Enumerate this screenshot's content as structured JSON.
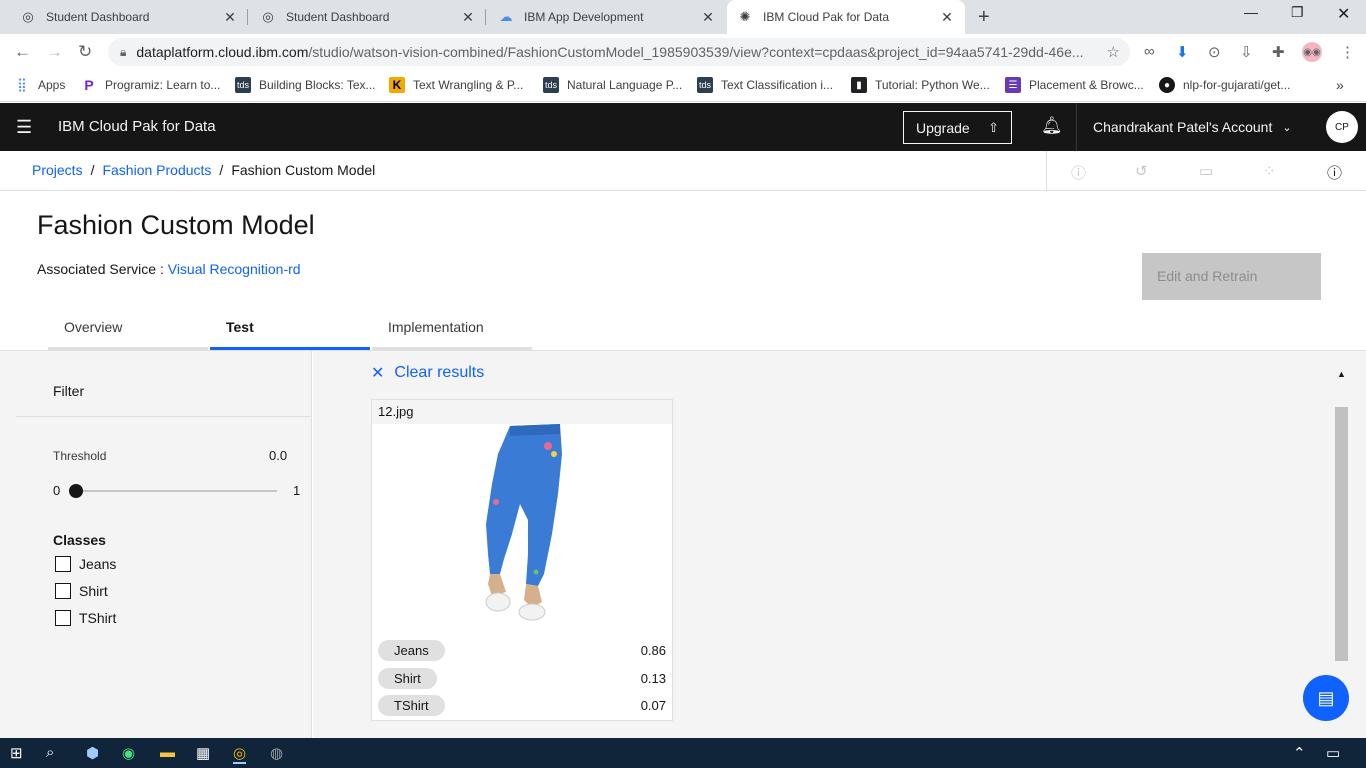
{
  "browser": {
    "tabs": [
      {
        "title": "Student Dashboard",
        "active": false
      },
      {
        "title": "Student Dashboard",
        "active": false
      },
      {
        "title": "IBM App Development",
        "active": false
      },
      {
        "title": "IBM Cloud Pak for Data",
        "active": true
      }
    ],
    "url_host": "dataplatform.cloud.ibm.com",
    "url_path": "/studio/watson-vision-combined/FashionCustomModel_1985903539/view?context=cpdaas&project_id=94aa5741-29dd-46e...",
    "bookmarks": [
      {
        "label": "Apps",
        "icon": "apps-grid-icon",
        "color": "#4285f4"
      },
      {
        "label": "Programiz: Learn to...",
        "icon": "programiz-icon",
        "color": "#6c2bd9"
      },
      {
        "label": "Building Blocks: Tex...",
        "icon": "tds-icon",
        "color": "#2d3e50"
      },
      {
        "label": "Text Wrangling & P...",
        "icon": "kaggle-icon",
        "color": "#f2a900"
      },
      {
        "label": "Natural Language P...",
        "icon": "tds-icon",
        "color": "#2d3e50"
      },
      {
        "label": "Text Classification i...",
        "icon": "tds-icon",
        "color": "#2d3e50"
      },
      {
        "label": "Tutorial: Python We...",
        "icon": "bookmark-icon",
        "color": "#202124"
      },
      {
        "label": "Placement & Browc...",
        "icon": "form-icon",
        "color": "#673ab7"
      },
      {
        "label": "nlp-for-gujarati/get...",
        "icon": "github-icon",
        "color": "#161616"
      }
    ]
  },
  "header": {
    "brand": "IBM Cloud Pak for Data",
    "upgrade": "Upgrade",
    "account": "Chandrakant Patel's Account",
    "avatar": "CP"
  },
  "breadcrumb": {
    "projects": "Projects",
    "project": "Fashion Products",
    "current": "Fashion Custom Model"
  },
  "page": {
    "title": "Fashion Custom Model",
    "assoc_label": "Associated Service : ",
    "assoc_link": "Visual Recognition-rd",
    "retrain": "Edit and Retrain",
    "tabs": [
      "Overview",
      "Test",
      "Implementation"
    ],
    "active_tab": "Test"
  },
  "filter": {
    "heading": "Filter",
    "threshold_label": "Threshold",
    "threshold_value": "0.0",
    "slider_min": "0",
    "slider_max": "1",
    "classes_heading": "Classes",
    "classes": [
      "Jeans",
      "Shirt",
      "TShirt"
    ]
  },
  "results": {
    "clear_label": "Clear results",
    "file_name": "12.jpg",
    "scores": [
      {
        "label": "Jeans",
        "score": "0.86"
      },
      {
        "label": "Shirt",
        "score": "0.13"
      },
      {
        "label": "TShirt",
        "score": "0.07"
      }
    ]
  },
  "colors": {
    "accent": "#0f62fe",
    "header_bg": "#161616",
    "jeans_blue": "#3a7bd5"
  }
}
